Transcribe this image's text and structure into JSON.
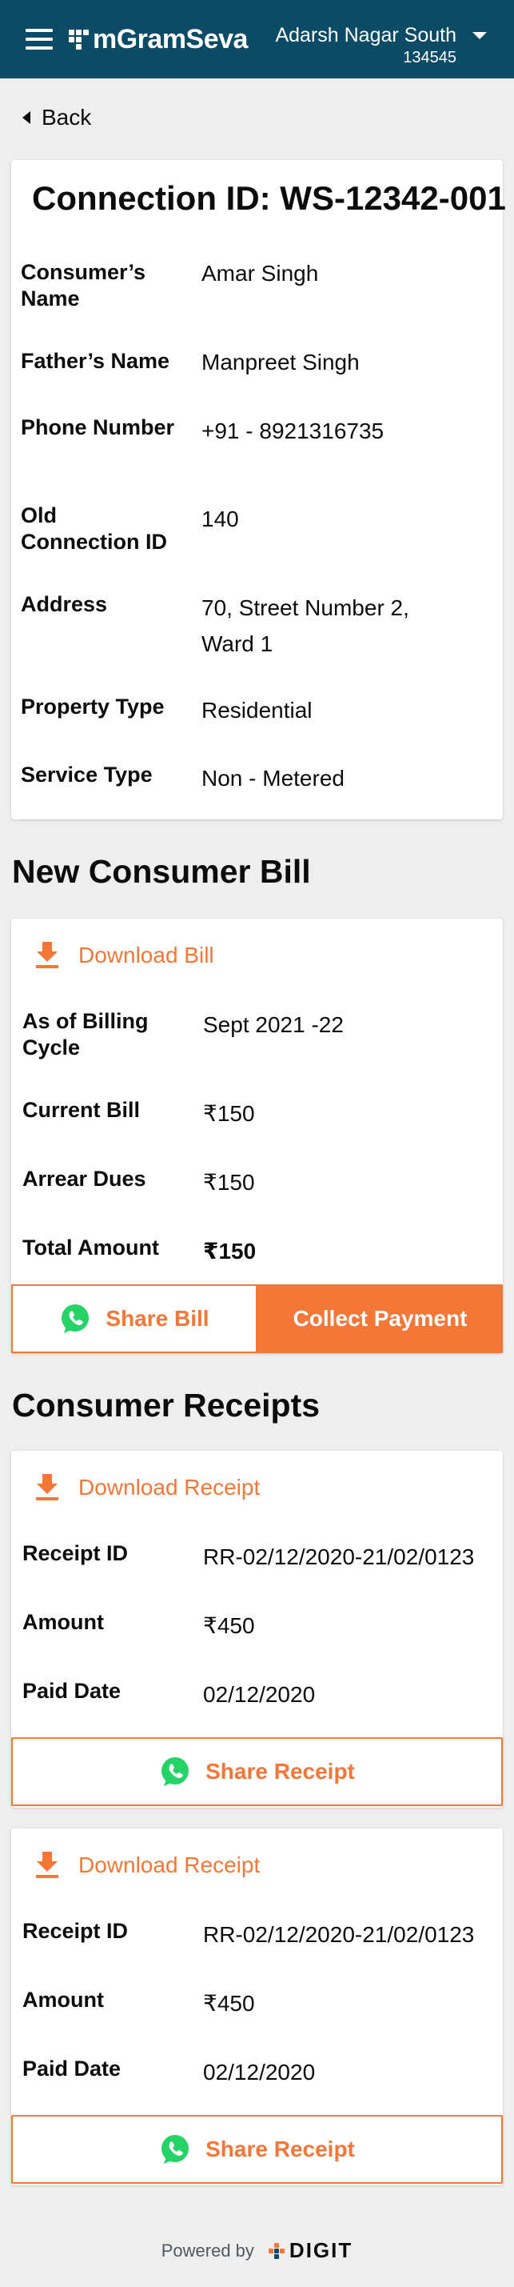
{
  "header": {
    "app_name": "mGramSeva",
    "location_name": "Adarsh Nagar South",
    "location_code": "134545"
  },
  "nav": {
    "back_label": "Back"
  },
  "connection": {
    "title": "Connection ID: WS-12342-001",
    "fields": [
      {
        "label": "Consumer’s Name",
        "value": "Amar Singh"
      },
      {
        "label": "Father’s Name",
        "value": "Manpreet Singh"
      },
      {
        "label": "Phone Number",
        "value": "+91 - 8921316735"
      },
      {
        "label": "Old Connection ID",
        "value": "140"
      },
      {
        "label": "Address",
        "value": "70, Street Number 2, Ward 1"
      },
      {
        "label": "Property Type",
        "value": "Residential"
      },
      {
        "label": "Service Type",
        "value": "Non - Metered"
      }
    ]
  },
  "bill": {
    "section_title": "New Consumer Bill",
    "download_label": "Download Bill",
    "fields": [
      {
        "label": "As of Billing Cycle",
        "value": "Sept 2021 -22"
      },
      {
        "label": "Current Bill",
        "value": "₹150"
      },
      {
        "label": "Arrear Dues",
        "value": "₹150"
      },
      {
        "label": "Total Amount",
        "value": "₹150"
      }
    ],
    "share_label": "Share Bill",
    "collect_label": "Collect Payment"
  },
  "receipts": {
    "section_title": "Consumer Receipts",
    "items": [
      {
        "download_label": "Download Receipt",
        "fields": [
          {
            "label": "Receipt ID",
            "value": "RR-02/12/2020-21/02/0123"
          },
          {
            "label": "Amount",
            "value": "₹450"
          },
          {
            "label": "Paid Date",
            "value": "02/12/2020"
          }
        ],
        "share_label": "Share Receipt"
      },
      {
        "download_label": "Download Receipt",
        "fields": [
          {
            "label": "Receipt ID",
            "value": "RR-02/12/2020-21/02/0123"
          },
          {
            "label": "Amount",
            "value": "₹450"
          },
          {
            "label": "Paid Date",
            "value": "02/12/2020"
          }
        ],
        "share_label": "Share Receipt"
      }
    ]
  },
  "footer": {
    "powered_by": "Powered by",
    "brand": "DIGIT"
  },
  "colors": {
    "header_bg": "#0b4b66",
    "accent": "#f47738",
    "page_bg": "#eeeeee",
    "whatsapp": "#25d366"
  },
  "icons": [
    "menu-icon",
    "brand-logo-icon",
    "chevron-down-icon",
    "back-caret-icon",
    "download-icon",
    "whatsapp-icon",
    "digit-logo-icon"
  ]
}
